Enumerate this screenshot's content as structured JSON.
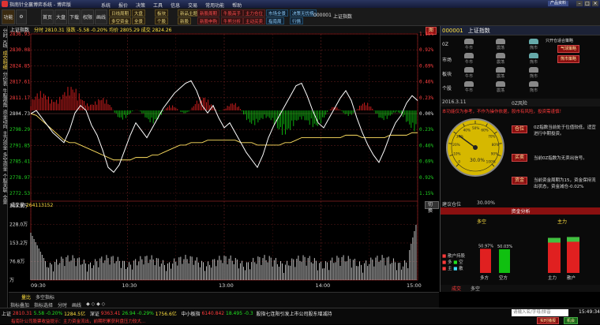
{
  "window": {
    "title": "指南针全赢博弈系统 - 博弈版",
    "menu": [
      "系统",
      "报价",
      "决策",
      "工具",
      "信息",
      "交易",
      "常用功能",
      "帮助"
    ],
    "product_btn": "产品资料"
  },
  "toolbar": {
    "big_buttons": [
      "功能",
      "首页",
      "大盘",
      "下载",
      "权限",
      "画线"
    ],
    "small_tags": [
      [
        "日线周期",
        "大盘"
      ],
      [
        "多空资金",
        "全景"
      ],
      [
        "板块",
        "个股"
      ],
      [
        "新品主题",
        "新股"
      ]
    ],
    "red_tags": [
      [
        "新股周期",
        "新股申购"
      ],
      [
        "牛股高手",
        "牛熊分析"
      ],
      [
        "主力仓位",
        "主动买卖"
      ]
    ],
    "blue_tags": [
      [
        "市场全景",
        "指南周"
      ],
      [
        "决策无忧榜",
        "行情"
      ]
    ],
    "stock_code": "000001",
    "stock_name": "上证指数"
  },
  "side_tabs": [
    "分时",
    "K线",
    "成交明细",
    "分价表",
    "牛股视角",
    "资金动向",
    "主力资金",
    "多空资金",
    "个股关联",
    "全景"
  ],
  "chart": {
    "name": "上证指数",
    "info": "分时 2810.31 涨跌 -5.58 -0.20% 均价 2805.29 成交 2824.26",
    "range_btn": "图",
    "price_labels": [
      "2836.93",
      "2830.08",
      "2824.85",
      "2817.61",
      "2811.17",
      "2804.73",
      "2798.29",
      "2791.85",
      "2785.41",
      "2778.97",
      "2772.53"
    ],
    "pct_labels": [
      "1.15%",
      "0.92%",
      "0.69%",
      "0.46%",
      "0.23%",
      "0.00%",
      "0.23%",
      "0.46%",
      "0.69%",
      "0.92%",
      "1.15%"
    ],
    "vol_title": "成交量",
    "vol_value": "264113152",
    "vol_labels": [
      "303.9万",
      "228.0万",
      "153.2万",
      "76.8万",
      "万"
    ],
    "time_labels": [
      "09:30",
      "10:30",
      "13:00",
      "14:00",
      "15:00"
    ],
    "switch_btn": "切换"
  },
  "chart_data": {
    "type": "line",
    "x_range": [
      "09:30",
      "15:00"
    ],
    "ylim": [
      2772.53,
      2836.93
    ],
    "price": [
      2804.7,
      2806,
      2803,
      2800,
      2797,
      2795,
      2793,
      2798,
      2805,
      2808,
      2806,
      2800,
      2796,
      2790,
      2783,
      2781,
      2784,
      2790,
      2796,
      2801,
      2798,
      2795,
      2799,
      2803,
      2807,
      2810,
      2813,
      2815,
      2817,
      2818,
      2814,
      2808,
      2805,
      2808,
      2803,
      2799,
      2801,
      2797,
      2793,
      2789,
      2786,
      2783,
      2788,
      2795,
      2800,
      2804,
      2808,
      2812,
      2816,
      2817,
      2812,
      2806,
      2801,
      2799,
      2803,
      2807,
      2811,
      2814,
      2810,
      2803,
      2797,
      2792,
      2788,
      2785,
      2790,
      2796,
      2801,
      2804,
      2809,
      2812,
      2810
    ],
    "avg": [
      2804.7,
      2804,
      2802,
      2800,
      2798,
      2796,
      2794,
      2793,
      2793,
      2792,
      2791,
      2790,
      2789,
      2788,
      2787,
      2786,
      2786,
      2786,
      2786,
      2787,
      2787,
      2787,
      2788,
      2788,
      2789,
      2790,
      2791,
      2792,
      2792,
      2793,
      2793,
      2793,
      2794,
      2794,
      2794,
      2794,
      2794,
      2794,
      2793,
      2793,
      2793,
      2792,
      2792,
      2792,
      2792,
      2792,
      2793,
      2793,
      2794,
      2795,
      2795,
      2795,
      2795,
      2795,
      2795,
      2795,
      2795,
      2796,
      2796,
      2796,
      2795,
      2795,
      2795,
      2795,
      2795,
      2796,
      2796,
      2796,
      2796,
      2797,
      2797
    ]
  },
  "bottom_tabs": [
    "指标叠加",
    "指标选择",
    "分时",
    "画线"
  ],
  "bottom_tabs2": [
    "量比",
    "多空指标"
  ],
  "panel": {
    "code": "000001",
    "name": "上证指数",
    "flag": "图标",
    "market_rows": [
      [
        "0Z",
        "牛市",
        "震荡",
        "熊市"
      ],
      [
        "市场",
        "牛市",
        "震荡",
        "熊市"
      ],
      [
        "板块",
        "牛市",
        "震荡",
        "熊市"
      ],
      [
        "个股",
        "牛市",
        "震荡",
        "熊市"
      ]
    ],
    "right_labels": [
      "只开仓适合策略",
      "气球策略",
      "熊市策略"
    ],
    "date": "2016.3.11",
    "gauge_title": "0Z风险",
    "desc": "本功能仅为参考，不作为操作依据，股市有风险，投资需谨慎！",
    "pos_btn": "仓位",
    "pos_text": "0Z指数当前处于位值较低，适宜进行中期投资。",
    "buy_btn": "买卖",
    "buy_text": "当前0Z指数为无卖出信号。",
    "fund_btn": "资金",
    "fund_text": "当前资金周期为15，资金保持流出状态，资金减仓-0.02%",
    "gauge_value": "30.0%",
    "gauge_labels": [
      "0",
      "10%",
      "20%",
      "30%",
      "40%",
      "50%",
      "60%",
      "70%",
      "80%",
      "90%",
      "100%"
    ],
    "sugg_label": "建议仓位",
    "sugg_value": "30.00%",
    "fund_title": "资金分析",
    "fund_sub": [
      "多空",
      "主力"
    ],
    "legend": [
      "散户持股",
      "多",
      "空",
      "主",
      "散"
    ],
    "bar_vals": [
      "50.97%",
      "50.03%"
    ],
    "bar_labels": [
      "多方",
      "空方"
    ],
    "zhuli": [
      "主力",
      "散户"
    ],
    "zhuli_vals": [
      "49.51%",
      "50.49%"
    ],
    "tabs": [
      "成交",
      "多空"
    ],
    "extra_vals": [
      "0.15%",
      "0.08%"
    ],
    "extra_rows": [
      [
        "今天",
        "371.86",
        "0.31%"
      ],
      [
        "买入",
        "3071.66",
        "804.03"
      ],
      [
        "卖出",
        "2700.00",
        "-0.31%"
      ]
    ]
  },
  "status": {
    "row1": [
      "上证",
      "2810.31",
      "5.58",
      "-0.20%",
      "1284.5亿",
      "深证",
      "9363.41",
      "26.94",
      "-0.29%",
      "1756.6亿",
      "中小板指",
      "6140.842",
      "18.495",
      "-0.3",
      "股指七连阳引发上市公司股东增减持"
    ],
    "input_placeholder": "请输入名/字母/拼音",
    "time": "15:49:34",
    "row2": "指南针公司股票收益提示：主力资金流出，前期积累获利盘压力较大...",
    "alerts": [
      "实时播报",
      "机会"
    ]
  }
}
